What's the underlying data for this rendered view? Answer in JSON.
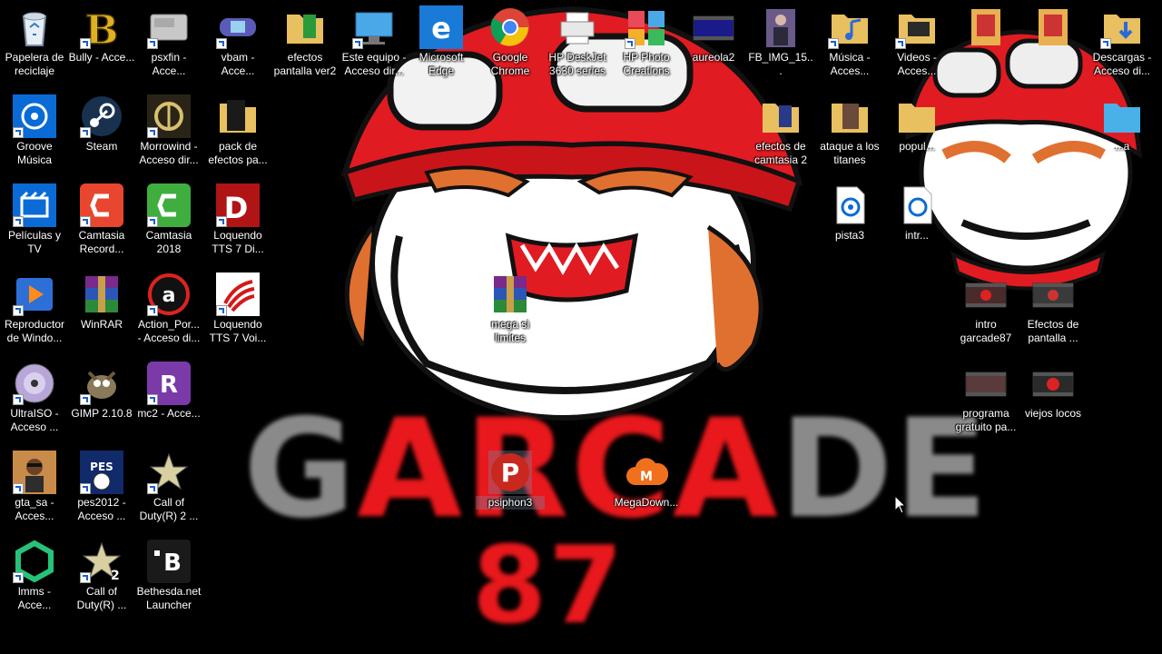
{
  "wallpaper": {
    "logo_line1_part_a": "G",
    "logo_line1_part_b": "ARCA",
    "logo_line1_part_c": "DE",
    "logo_line2": "87",
    "colors": {
      "red": "#e8181c",
      "grey": "#8a8a8a",
      "background": "#000000"
    }
  },
  "icons": {
    "recycle_bin": {
      "label": "Papelera de reciclaje",
      "icon": "recycle-bin-icon"
    },
    "bully": {
      "label": "Bully - Acce...",
      "icon": "bully-icon"
    },
    "psxfin": {
      "label": "psxfin - Acce...",
      "icon": "playstation-icon"
    },
    "vbam": {
      "label": "vbam - Acce...",
      "icon": "gameboy-icon"
    },
    "efectos_ver2": {
      "label": "efectos pantalla ver2",
      "icon": "folder-icon"
    },
    "este_equipo": {
      "label": "Este equipo - Acceso dir...",
      "icon": "computer-icon"
    },
    "edge": {
      "label": "Microsoft Edge",
      "icon": "edge-icon"
    },
    "chrome": {
      "label": "Google Chrome",
      "icon": "chrome-icon"
    },
    "hp_deskjet": {
      "label": "HP DeskJet 3630 series",
      "icon": "printer-icon"
    },
    "hp_photo": {
      "label": "HP Photo Creations",
      "icon": "photo-creations-icon"
    },
    "aureola2": {
      "label": "aureola2",
      "icon": "video-file-icon"
    },
    "fb_img": {
      "label": "FB_IMG_15...",
      "icon": "image-file-icon"
    },
    "musica": {
      "label": "Música - Acces...",
      "icon": "music-folder-icon"
    },
    "videos": {
      "label": "Videos - Acces...",
      "icon": "videos-folder-icon"
    },
    "descargas": {
      "label": "Descargas - Acceso di...",
      "icon": "downloads-folder-icon"
    },
    "groove": {
      "label": "Groove Música",
      "icon": "groove-icon"
    },
    "steam": {
      "label": "Steam",
      "icon": "steam-icon"
    },
    "morrowind": {
      "label": "Morrowind - Acceso dir...",
      "icon": "morrowind-icon"
    },
    "pack_efectos": {
      "label": "pack de efectos pa...",
      "icon": "folder-icon"
    },
    "efectos_camtasia2": {
      "label": "efectos de camtasia 2",
      "icon": "folder-icon"
    },
    "ataque_titanes": {
      "label": "ataque a los titanes",
      "icon": "folder-icon"
    },
    "populares": {
      "label": "popul...",
      "icon": "folder-icon"
    },
    "pista_folder": {
      "label": "...a",
      "icon": "folder-icon"
    },
    "peliculas": {
      "label": "Películas y TV",
      "icon": "movies-tv-icon"
    },
    "camtasia_recorder": {
      "label": "Camtasia Record...",
      "icon": "camtasia-recorder-icon"
    },
    "camtasia_2018": {
      "label": "Camtasia 2018",
      "icon": "camtasia-icon"
    },
    "loquendo_di": {
      "label": "Loquendo TTS 7 Di...",
      "icon": "loquendo-d-icon"
    },
    "pista3": {
      "label": "pista3",
      "icon": "audio-file-icon"
    },
    "intro_short": {
      "label": "intr...",
      "icon": "audio-file-icon"
    },
    "reproductor": {
      "label": "Reproductor de Windo...",
      "icon": "media-player-icon"
    },
    "winrar": {
      "label": "WinRAR",
      "icon": "winrar-icon"
    },
    "action_portable": {
      "label": "Action_Por... - Acceso di...",
      "icon": "action-icon"
    },
    "loquendo_voi": {
      "label": "Loquendo TTS 7 Voi...",
      "icon": "loquendo-icon"
    },
    "mega_sin_limites": {
      "label": "mega si limites",
      "icon": "winrar-icon"
    },
    "intro_garcade": {
      "label": "intro garcade87",
      "icon": "video-file-icon"
    },
    "efectos_pantalla": {
      "label": "Efectos de pantalla ...",
      "icon": "video-file-icon"
    },
    "ultraiso": {
      "label": "UltraISO - Acceso ...",
      "icon": "disc-icon"
    },
    "gimp": {
      "label": "GIMP 2.10.8",
      "icon": "gimp-icon"
    },
    "mc2": {
      "label": "mc2 - Acce...",
      "icon": "rockstar-icon"
    },
    "programa_gratuito": {
      "label": "programa gratuito pa...",
      "icon": "video-file-icon"
    },
    "viejos_locos": {
      "label": "viejos locos",
      "icon": "video-file-icon"
    },
    "gta_sa": {
      "label": "gta_sa - Acces...",
      "icon": "gta-icon"
    },
    "pes2012": {
      "label": "pes2012 - Acceso ...",
      "icon": "pes-icon"
    },
    "cod2": {
      "label": "Call of Duty(R) 2 ...",
      "icon": "call-of-duty-icon"
    },
    "psiphon3": {
      "label": "psiphon3",
      "icon": "psiphon-icon"
    },
    "megadownloader": {
      "label": "MegaDown...",
      "icon": "mega-cloud-icon"
    },
    "lmms": {
      "label": "lmms - Acce...",
      "icon": "lmms-icon"
    },
    "cod_r": {
      "label": "Call of Duty(R) ...",
      "icon": "call-of-duty-2-icon"
    },
    "bethesda": {
      "label": "Bethesda.net Launcher",
      "icon": "bethesda-icon"
    }
  }
}
